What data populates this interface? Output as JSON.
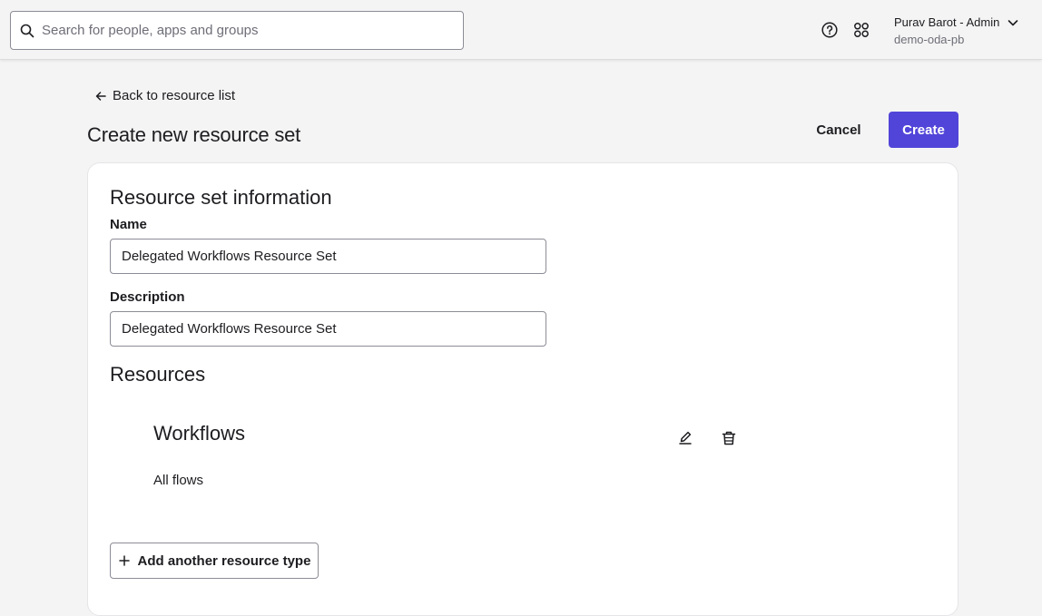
{
  "topbar": {
    "search_placeholder": "Search for people, apps and groups",
    "search_value": "",
    "help_icon": "help-circle-icon",
    "apps_icon": "apps-grid-icon",
    "user_name": "Purav Barot - Admin",
    "org_name": "demo-oda-pb"
  },
  "header": {
    "back_label": "Back to resource list",
    "page_title": "Create new resource set",
    "cancel_label": "Cancel",
    "create_label": "Create"
  },
  "form": {
    "info_heading": "Resource set information",
    "name_label": "Name",
    "name_value": "Delegated Workflows Resource Set",
    "description_label": "Description",
    "description_value": "Delegated Workflows Resource Set",
    "resources_heading": "Resources",
    "resource": {
      "title": "Workflows",
      "description": "All flows"
    },
    "add_resource_label": "Add another resource type"
  },
  "colors": {
    "primary": "#5145d9",
    "background": "#f4f4f4",
    "text": "#1d1d21"
  }
}
